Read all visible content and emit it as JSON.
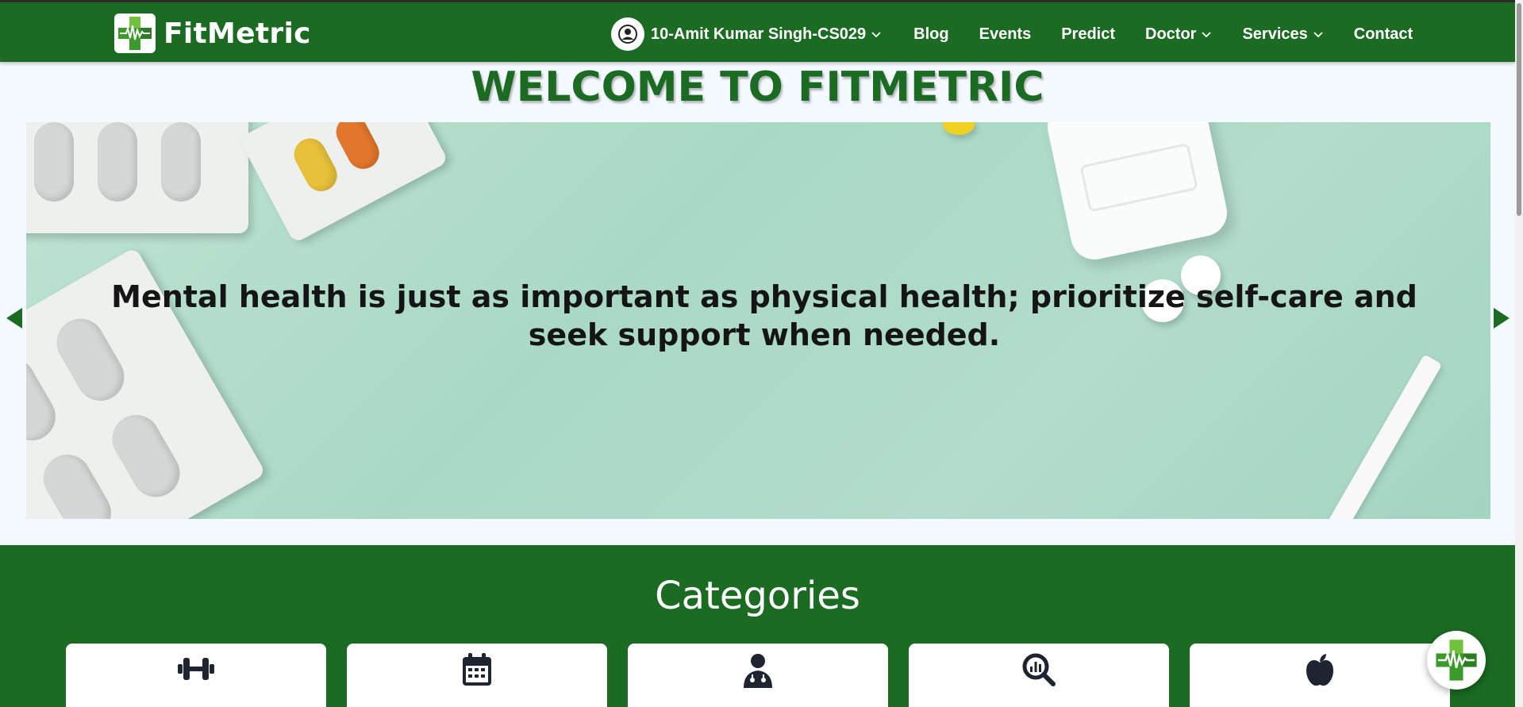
{
  "brand": {
    "name": "FitMetric",
    "color": "#1b6b22"
  },
  "nav": {
    "user_name": "10-Amit Kumar Singh-CS029",
    "links": [
      {
        "label": "Blog",
        "dropdown": false
      },
      {
        "label": "Events",
        "dropdown": false
      },
      {
        "label": "Predict",
        "dropdown": false
      },
      {
        "label": "Doctor",
        "dropdown": true
      },
      {
        "label": "Services",
        "dropdown": true
      },
      {
        "label": "Contact",
        "dropdown": false
      }
    ]
  },
  "welcome": {
    "title": "WELCOME TO FITMETRIC"
  },
  "hero": {
    "quote": "Mental health is just as important as physical health; prioritize self-care and seek support when needed."
  },
  "categories": {
    "title": "Categories",
    "items": [
      {
        "icon": "dumbbell-icon"
      },
      {
        "icon": "calendar-icon"
      },
      {
        "icon": "doctor-icon"
      },
      {
        "icon": "analytics-search-icon"
      },
      {
        "icon": "apple-icon"
      }
    ]
  },
  "colors": {
    "primary_green": "#1b6b22",
    "page_bg": "#f4f8ff",
    "hero_bg": "#b2dccb"
  }
}
